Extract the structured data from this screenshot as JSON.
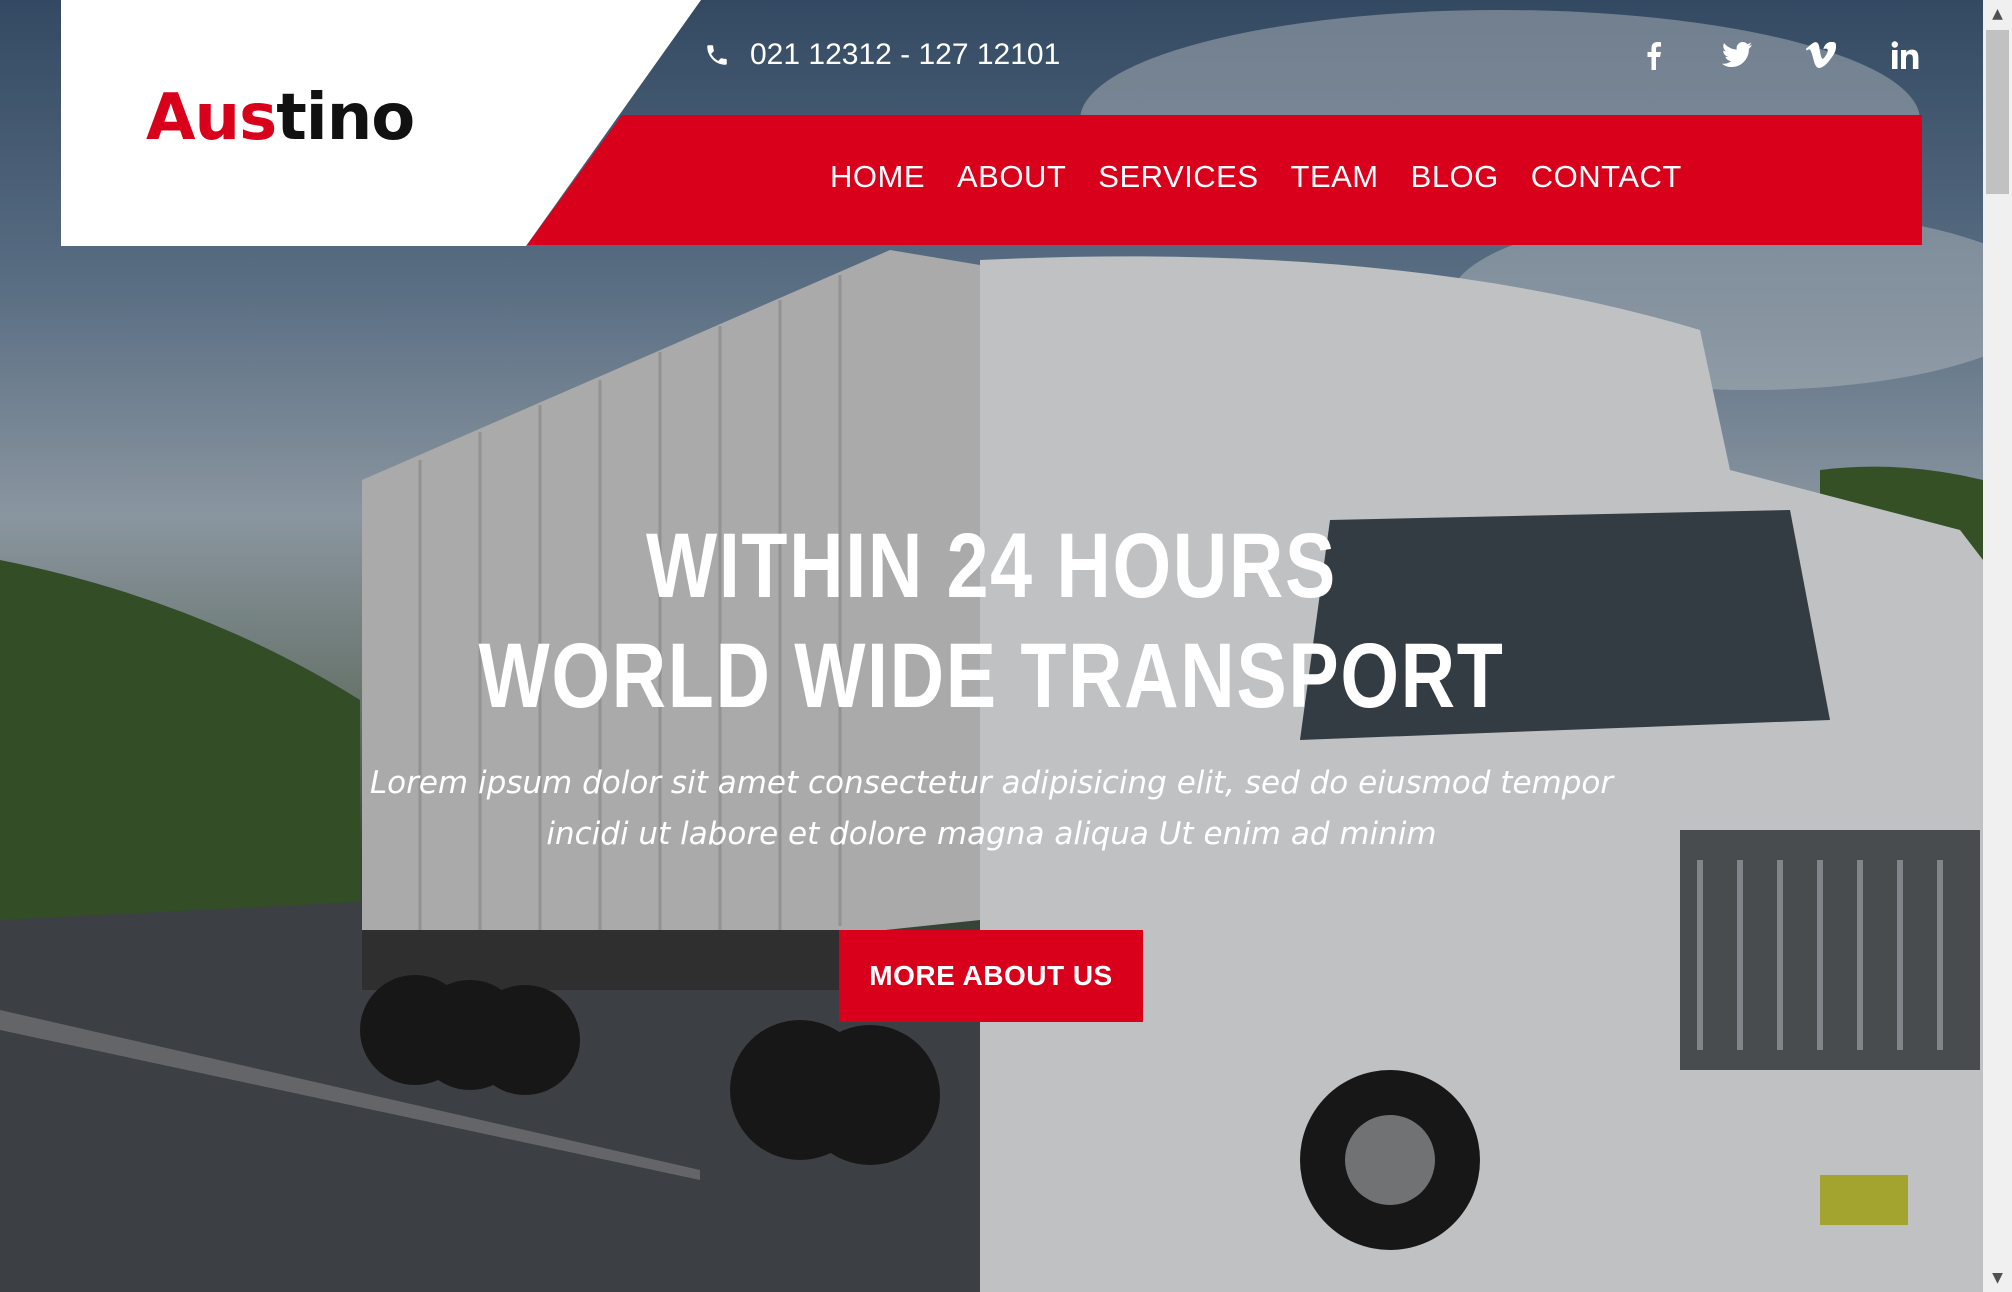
{
  "brand": {
    "logo_part1": "Aus",
    "logo_part2": "tino"
  },
  "topbar": {
    "phone_icon": "phone-icon",
    "phone": "021 12312 - 127 12101",
    "socials": [
      {
        "icon": "facebook-icon",
        "glyph": "f"
      },
      {
        "icon": "twitter-icon",
        "glyph": "t"
      },
      {
        "icon": "vimeo-icon",
        "glyph": "v"
      },
      {
        "icon": "linkedin-icon",
        "glyph": "in"
      }
    ]
  },
  "nav": {
    "items": [
      "HOME",
      "ABOUT",
      "SERVICES",
      "TEAM",
      "BLOG",
      "CONTACT"
    ]
  },
  "hero": {
    "title_line1": "WITHIN 24 HOURS",
    "title_line2": "WORLD WIDE TRANSPORT",
    "text_line1": "Lorem ipsum dolor sit amet consectetur adipisicing elit, sed do eiusmod tempor",
    "text_line2": "incidi ut labore et dolore magna aliqua Ut enim ad minim",
    "button": "MORE ABOUT US",
    "background_image": "white truck on highway"
  },
  "colors": {
    "accent": "#d9001b",
    "dark": "#111111",
    "white": "#ffffff"
  }
}
